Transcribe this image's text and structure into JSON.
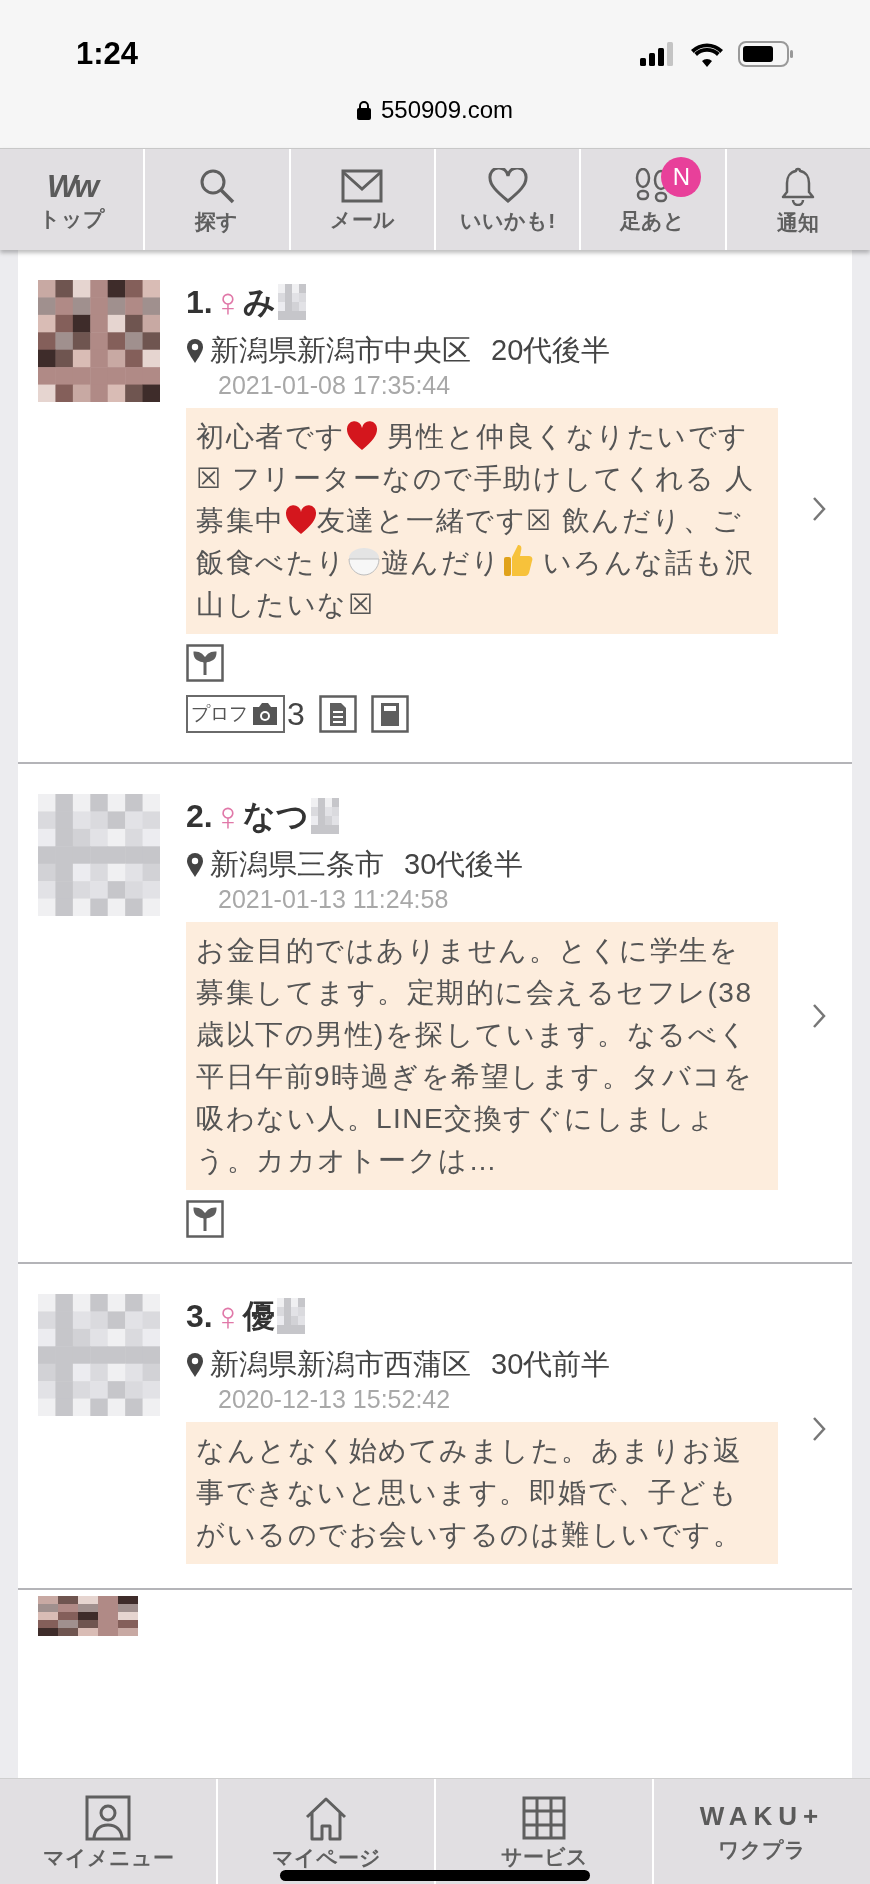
{
  "status_bar": {
    "time": "1:24"
  },
  "browser": {
    "url": "550909.com"
  },
  "top_nav": [
    {
      "kind": "logo",
      "logo": "Ww",
      "label": "トップ"
    },
    {
      "kind": "search",
      "label": "探す"
    },
    {
      "kind": "mail",
      "label": "メール"
    },
    {
      "kind": "heart",
      "label": "いいかも!"
    },
    {
      "kind": "footprints",
      "label": "足あと",
      "badge": "N"
    },
    {
      "kind": "bell",
      "label": "通知"
    }
  ],
  "profiles": [
    {
      "avatar": {
        "kind": "picture"
      },
      "rank": "1.",
      "gender": "♀",
      "name": "み",
      "location": "新潟県新潟市中央区",
      "age": "20代後半",
      "date": "2021-01-08 17:35:44",
      "message": [
        {
          "kind": "text",
          "text": "初心者です"
        },
        {
          "kind": "heart"
        },
        {
          "kind": "text",
          "text": " 男性と仲良くなりたいです☒ フリーターなので手助けしてくれる 人募集中"
        },
        {
          "kind": "heart"
        },
        {
          "kind": "text",
          "text": "友達と一緒です☒ 飲んだり、ご飯食べたり"
        },
        {
          "kind": "rice"
        },
        {
          "kind": "text",
          "text": "遊んだり"
        },
        {
          "kind": "thumb"
        },
        {
          "kind": "text",
          "text": " いろんな話も沢山したいな☒"
        }
      ],
      "tags": [
        {
          "kind": "sprout"
        }
      ],
      "extras": [
        {
          "label": "プロフ",
          "count": "3"
        },
        {
          "kind": "document"
        },
        {
          "kind": "notebook"
        }
      ]
    },
    {
      "avatar": {
        "kind": "picture"
      },
      "rank": "2.",
      "gender": "♀",
      "name": "なつ",
      "location": "新潟県三条市",
      "age": "30代後半",
      "date": "2021-01-13 11:24:58",
      "message": [
        {
          "kind": "text",
          "text": "お金目的ではありません。とくに学生を募集してます。定期的に会えるセフレ(38歳以下の男性)を探しています。なるべく平日午前9時過ぎを希望します。タバコを吸わない人。LINE交換すぐにしましょう。カカオトークは…"
        }
      ],
      "tags": [
        {
          "kind": "sprout"
        }
      ]
    },
    {
      "avatar": {
        "kind": "picture"
      },
      "rank": "3.",
      "gender": "♀",
      "name": "優",
      "location": "新潟県新潟市西蒲区",
      "age": "30代前半",
      "date": "2020-12-13 15:52:42",
      "message": [
        {
          "kind": "text",
          "text": "なんとなく始めてみました。あまりお返事できないと思います。即婚で、子どもがいるのでお会いするのは難しいです。"
        }
      ]
    },
    {
      "avatar": {
        "kind": "picture"
      }
    }
  ],
  "bottom_nav": [
    {
      "kind": "person",
      "label": "マイメニュー"
    },
    {
      "kind": "home",
      "label": "マイページ"
    },
    {
      "kind": "grid",
      "label": "サービス"
    },
    {
      "kind": "logo",
      "logo": "WAKU+",
      "label": "ワクプラ"
    }
  ]
}
